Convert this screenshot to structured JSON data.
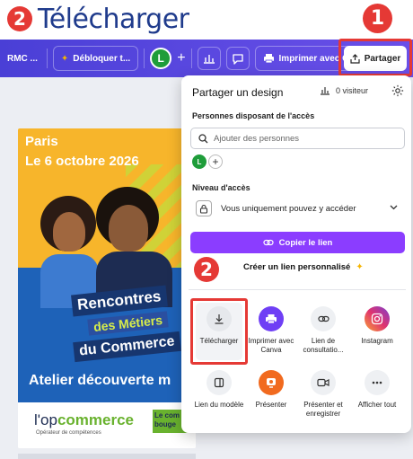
{
  "step_header": {
    "number": "2",
    "title": "Télécharger"
  },
  "markers": {
    "top": "1",
    "middle": "2"
  },
  "toolbar": {
    "truncated_left": "RMC ...",
    "unlock_label": "Débloquer t...",
    "avatar_letter": "L",
    "print_label": "Imprimer avec Canva",
    "share_label": "Partager"
  },
  "design": {
    "city": "Paris",
    "date": "Le 6 octobre 2026",
    "banner_line1": "Rencontres",
    "banner_line2": "des Métiers",
    "banner_line3": "du Commerce",
    "subtitle": "Atelier découverte m",
    "logo_prefix": "l'op",
    "logo_accent": "commerce",
    "logo_sub": "Opérateur de compétences",
    "logo2_text": "Le com bouge"
  },
  "share_panel": {
    "title": "Partager un design",
    "visitors": "0 visiteur",
    "people_label": "Personnes disposant de l'accès",
    "search_placeholder": "Ajouter des personnes",
    "user_avatar": "L",
    "access_label": "Niveau d'accès",
    "access_value": "Vous uniquement pouvez y accéder",
    "copy_link": "Copier le lien",
    "custom_link": "Créer un lien personnalisé",
    "tiles": [
      {
        "label": "Télécharger"
      },
      {
        "label": "Imprimer avec Canva"
      },
      {
        "label": "Lien de consultatio..."
      },
      {
        "label": "Instagram"
      },
      {
        "label": "Lien du modèle"
      },
      {
        "label": "Présenter"
      },
      {
        "label": "Présenter et enregistrer"
      },
      {
        "label": "Afficher tout"
      }
    ]
  },
  "colors": {
    "toolbar_start": "#4a3fd6",
    "accent_purple": "#8b3dff",
    "highlight_red": "#e53935",
    "title_blue": "#1f3b8c"
  }
}
